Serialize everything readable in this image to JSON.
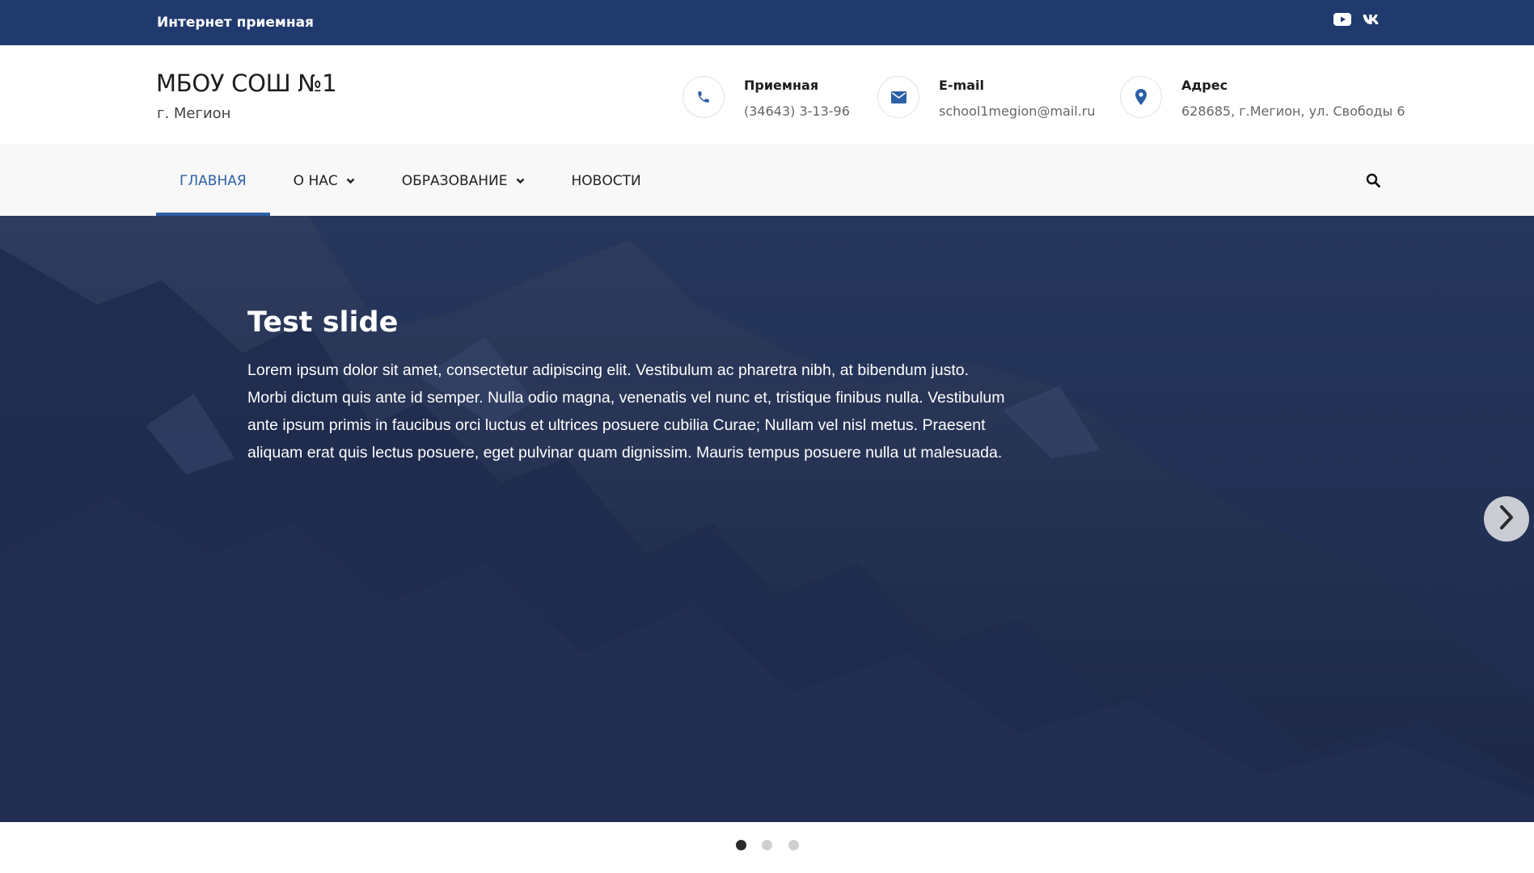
{
  "topbar": {
    "link_label": "Интернет приемная",
    "social": [
      "youtube-icon",
      "vk-icon"
    ],
    "background": "#213a6e"
  },
  "header": {
    "title": "МБОУ СОШ №1",
    "subtitle": "г. Мегион",
    "contacts": [
      {
        "icon": "phone-icon",
        "label": "Приемная",
        "value": "(34643) 3-13-96"
      },
      {
        "icon": "envelope-icon",
        "label": "E-mail",
        "value": "school1megion@mail.ru"
      },
      {
        "icon": "map-pin-icon",
        "label": "Адрес",
        "value": "628685, г.Мегион, ул. Свободы 6"
      }
    ],
    "accent": "#2d5fa6"
  },
  "nav": {
    "items": [
      {
        "label": "ГЛАВНАЯ",
        "active": true,
        "dropdown": false
      },
      {
        "label": "О НАС",
        "active": false,
        "dropdown": true
      },
      {
        "label": "ОБРАЗОВАНИЕ",
        "active": false,
        "dropdown": true
      },
      {
        "label": "НОВОСТИ",
        "active": false,
        "dropdown": false
      }
    ],
    "search_icon": "search-icon"
  },
  "slider": {
    "title": "Test slide",
    "body": "Lorem ipsum dolor sit amet, consectetur adipiscing elit. Vestibulum ac pharetra nibh, at bibendum justo. Morbi dictum quis ante id semper. Nulla odio magna, venenatis vel nunc et, tristique finibus nulla. Vestibulum ante ipsum primis in faucibus orci luctus et ultrices posuere cubilia Curae; Nullam vel nisl metus. Praesent aliquam erat quis lectus posuere, eget pulvinar quam dignissim. Mauris tempus posuere nulla ut malesuada.",
    "next_icon": "chevron-right-icon",
    "dots": 3,
    "active_dot": 1
  }
}
